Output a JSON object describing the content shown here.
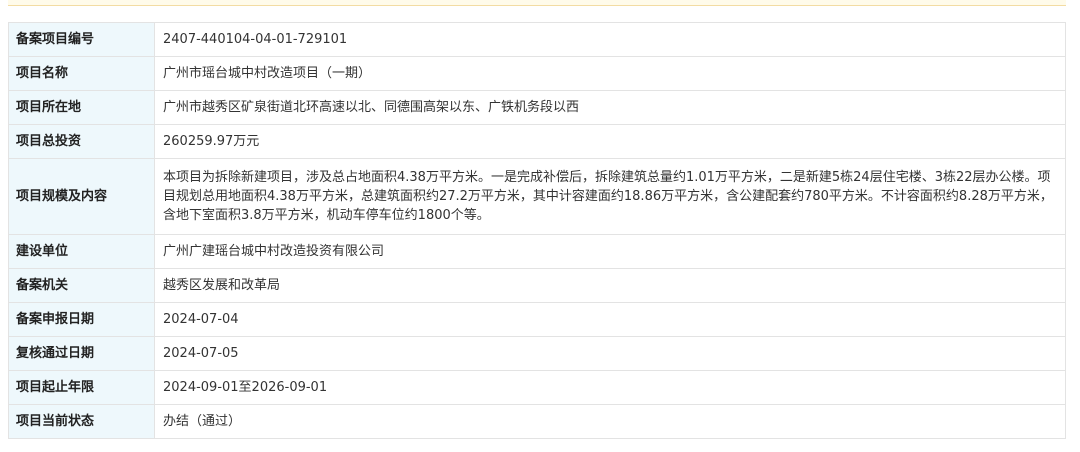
{
  "record": {
    "rows": [
      {
        "label": "备案项目编号",
        "value": "2407-440104-04-01-729101"
      },
      {
        "label": "项目名称",
        "value": "广州市瑶台城中村改造项目（一期）"
      },
      {
        "label": "项目所在地",
        "value": "广州市越秀区矿泉街道北环高速以北、同德围高架以东、广铁机务段以西"
      },
      {
        "label": "项目总投资",
        "value": "260259.97万元"
      },
      {
        "label": "项目规模及内容",
        "value": "本项目为拆除新建项目，涉及总占地面积4.38万平方米。一是完成补偿后，拆除建筑总量约1.01万平方米，二是新建5栋24层住宅楼、3栋22层办公楼。项目规划总用地面积4.38万平方米，总建筑面积约27.2万平方米，其中计容建面约18.86万平方米，含公建配套约780平方米。不计容面积约8.28万平方米，含地下室面积3.8万平方米，机动车停车位约1800个等。"
      },
      {
        "label": "建设单位",
        "value": "广州广建瑶台城中村改造投资有限公司"
      },
      {
        "label": "备案机关",
        "value": "越秀区发展和改革局"
      },
      {
        "label": "备案申报日期",
        "value": "2024-07-04"
      },
      {
        "label": "复核通过日期",
        "value": "2024-07-05"
      },
      {
        "label": "项目起止年限",
        "value": "2024-09-01至2026-09-01"
      },
      {
        "label": "项目当前状态",
        "value": "办结（通过）"
      }
    ]
  }
}
